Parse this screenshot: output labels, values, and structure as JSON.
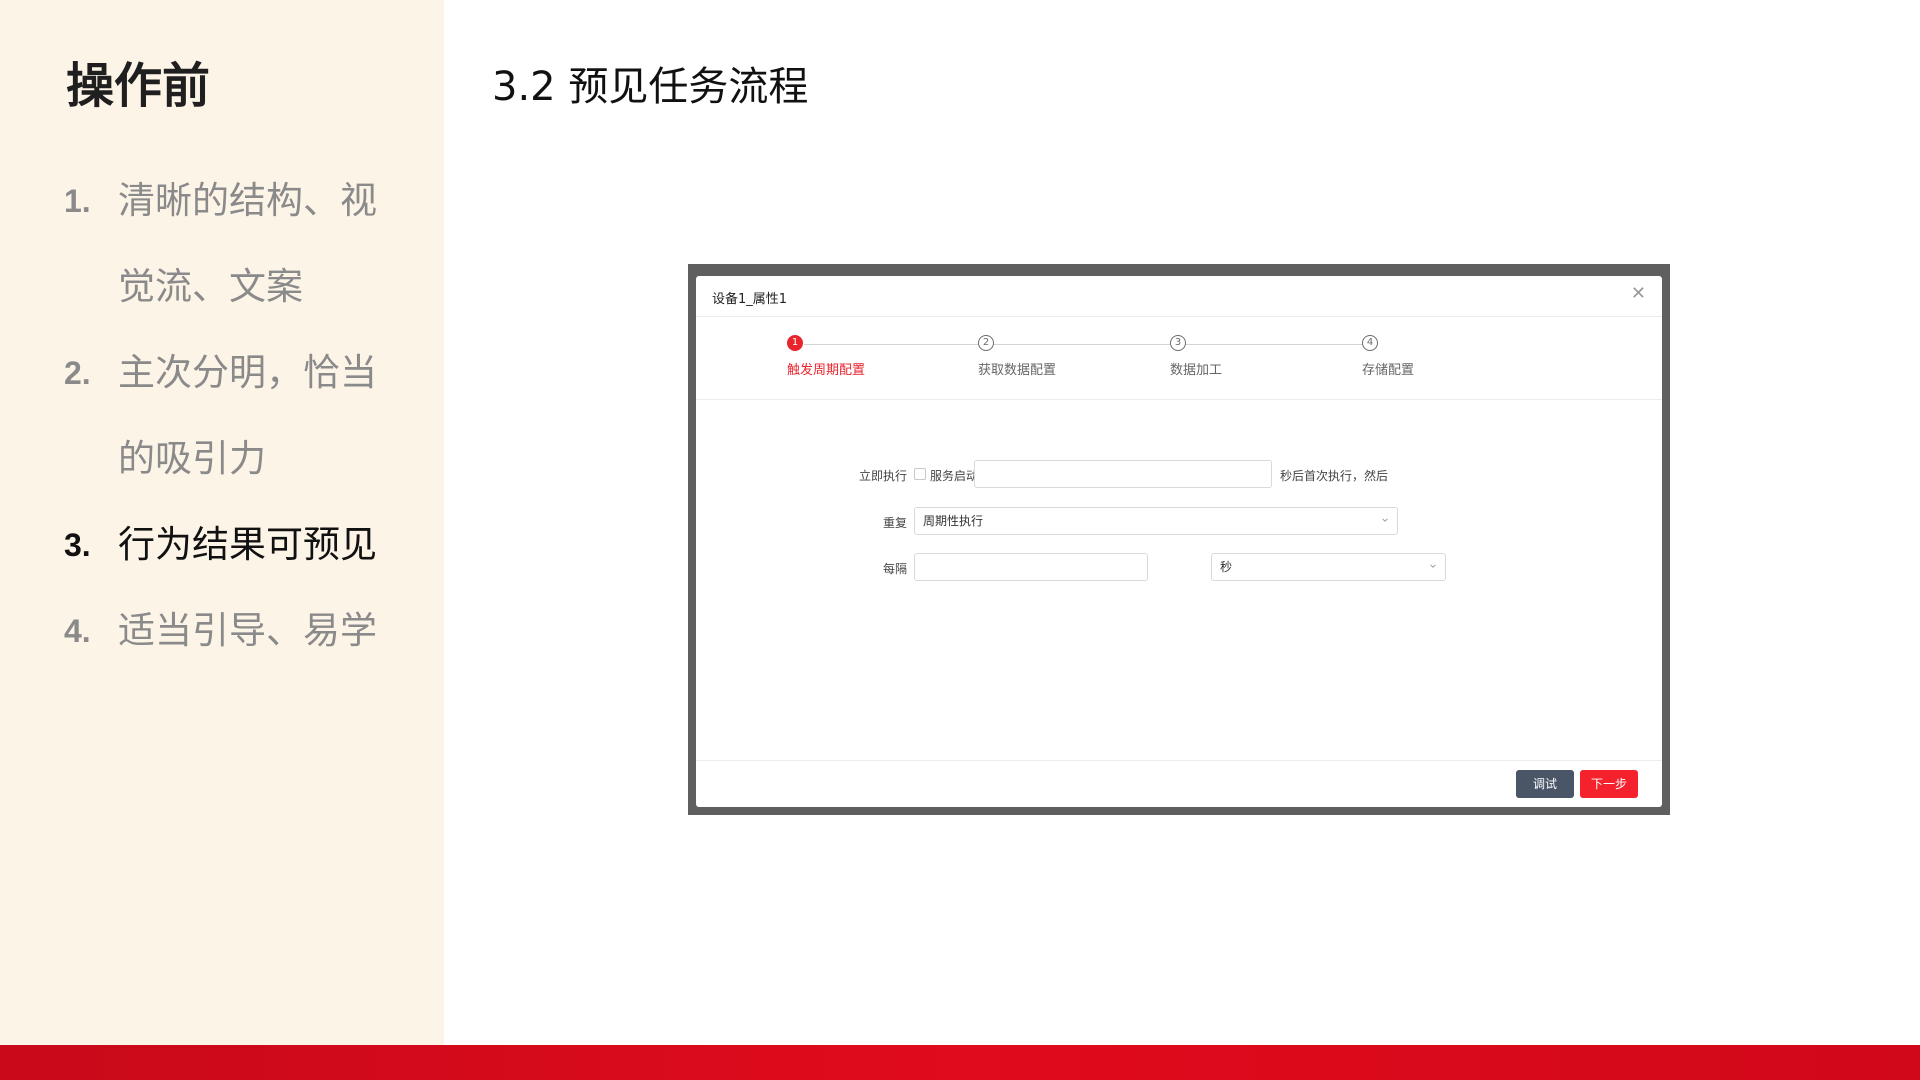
{
  "sidebar": {
    "title": "操作前",
    "items": [
      {
        "num": "1.",
        "text": "清晰的结构、视觉流、文案",
        "active": false
      },
      {
        "num": "2.",
        "text": "主次分明，恰当的吸引力",
        "active": false
      },
      {
        "num": "3.",
        "text": "行为结果可预见",
        "active": true
      },
      {
        "num": "4.",
        "text": "适当引导、易学",
        "active": false
      }
    ]
  },
  "main": {
    "title": "3.2 预见任务流程"
  },
  "dialog": {
    "title": "设备1_属性1",
    "close_icon": "close-icon",
    "steps": [
      {
        "num": "1",
        "label": "触发周期配置",
        "active": true
      },
      {
        "num": "2",
        "label": "获取数据配置",
        "active": false
      },
      {
        "num": "3",
        "label": "数据加工",
        "active": false
      },
      {
        "num": "4",
        "label": "存储配置",
        "active": false
      }
    ],
    "form": {
      "row1_label": "立即执行",
      "checkbox_label": "服务启动",
      "delay_input_value": "",
      "after_text": "秒后首次执行，然后",
      "repeat_label": "重复",
      "repeat_value": "周期性执行",
      "interval_label": "每隔",
      "interval_value": "",
      "unit_value": "秒"
    },
    "footer": {
      "debug_label": "调试",
      "next_label": "下一步"
    }
  },
  "colors": {
    "accent_red": "#e8242d",
    "sidebar_bg": "#fdf4e8",
    "frame_gray": "#5f5f5f",
    "debug_button": "#4a5568"
  }
}
